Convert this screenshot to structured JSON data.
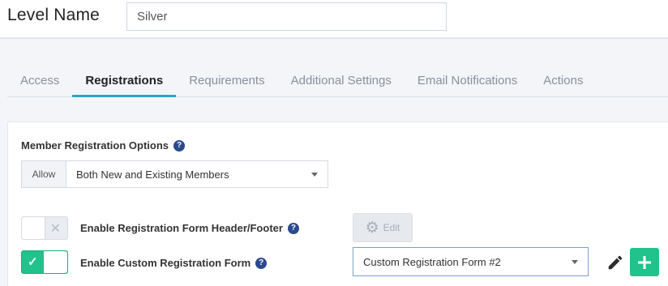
{
  "header": {
    "level_label": "Level Name",
    "level_value": "Silver"
  },
  "tabs": [
    {
      "label": "Access"
    },
    {
      "label": "Registrations"
    },
    {
      "label": "Requirements"
    },
    {
      "label": "Additional Settings"
    },
    {
      "label": "Email Notifications"
    },
    {
      "label": "Actions"
    }
  ],
  "active_tab": "Registrations",
  "registration": {
    "section_title": "Member Registration Options",
    "help_glyph": "?",
    "allow_label": "Allow",
    "allow_value": "Both New and Existing Members",
    "header_footer": {
      "label": "Enable Registration Form Header/Footer",
      "enabled": false,
      "edit_label": "Edit"
    },
    "custom_form": {
      "label": "Enable Custom Registration Form",
      "enabled": true,
      "selected_form": "Custom Registration Form #2"
    }
  },
  "icons": {
    "help": "help-icon",
    "gear": "gear-icon",
    "pencil": "pencil-icon",
    "plus": "plus-icon",
    "check": "check-icon",
    "close": "close-icon",
    "caret": "chevron-down-icon"
  },
  "colors": {
    "accent": "#2aa6c7",
    "toggle_on": "#21c28b",
    "help_badge": "#2b4a8e"
  }
}
